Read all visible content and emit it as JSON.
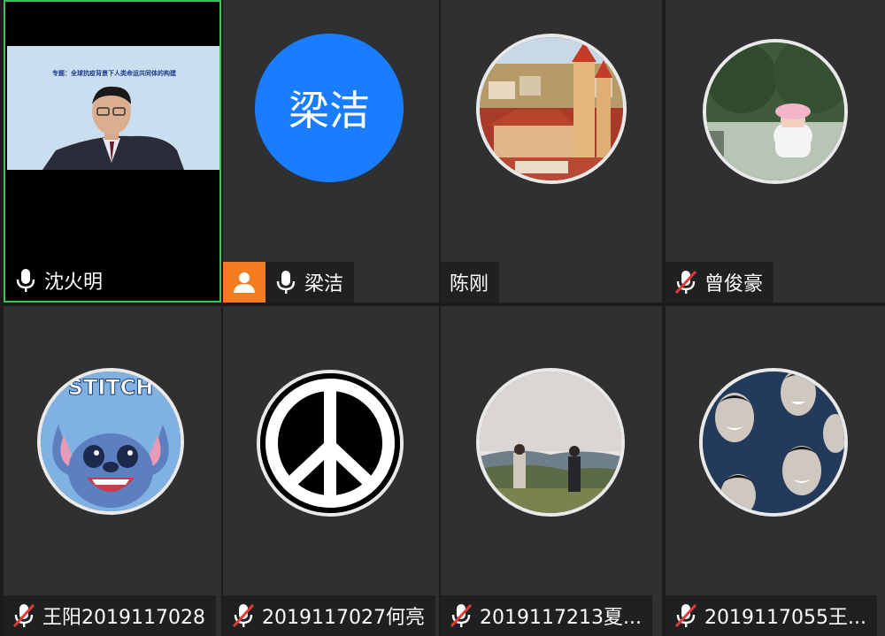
{
  "participants": [
    {
      "name": "沈火明",
      "mic": "on",
      "video": true,
      "slide_title": "专题：全球抗疫背景下人类命运共同体的构建"
    },
    {
      "name": "梁洁",
      "mic": "on",
      "avatar_text": "梁洁",
      "avatar_color": "#1a7dff",
      "host": true
    },
    {
      "name": "陈刚",
      "mic": "none",
      "avatar": "church-town-photo"
    },
    {
      "name": "曾俊豪",
      "mic": "muted",
      "avatar": "baby-in-hat-photo"
    },
    {
      "name": "王阳2019117028",
      "mic": "muted",
      "avatar": "stitch-cartoon"
    },
    {
      "name": "2019117027何亮",
      "mic": "muted",
      "avatar": "peace-symbol"
    },
    {
      "name": "2019117213夏...",
      "mic": "muted",
      "avatar": "couple-landscape-photo"
    },
    {
      "name": "2019117055王...",
      "mic": "muted",
      "avatar": "face-pattern"
    }
  ],
  "colors": {
    "active_speaker_border": "#3fbf5a",
    "muted_slash": "#e53935",
    "host_badge": "#f57c1f"
  }
}
